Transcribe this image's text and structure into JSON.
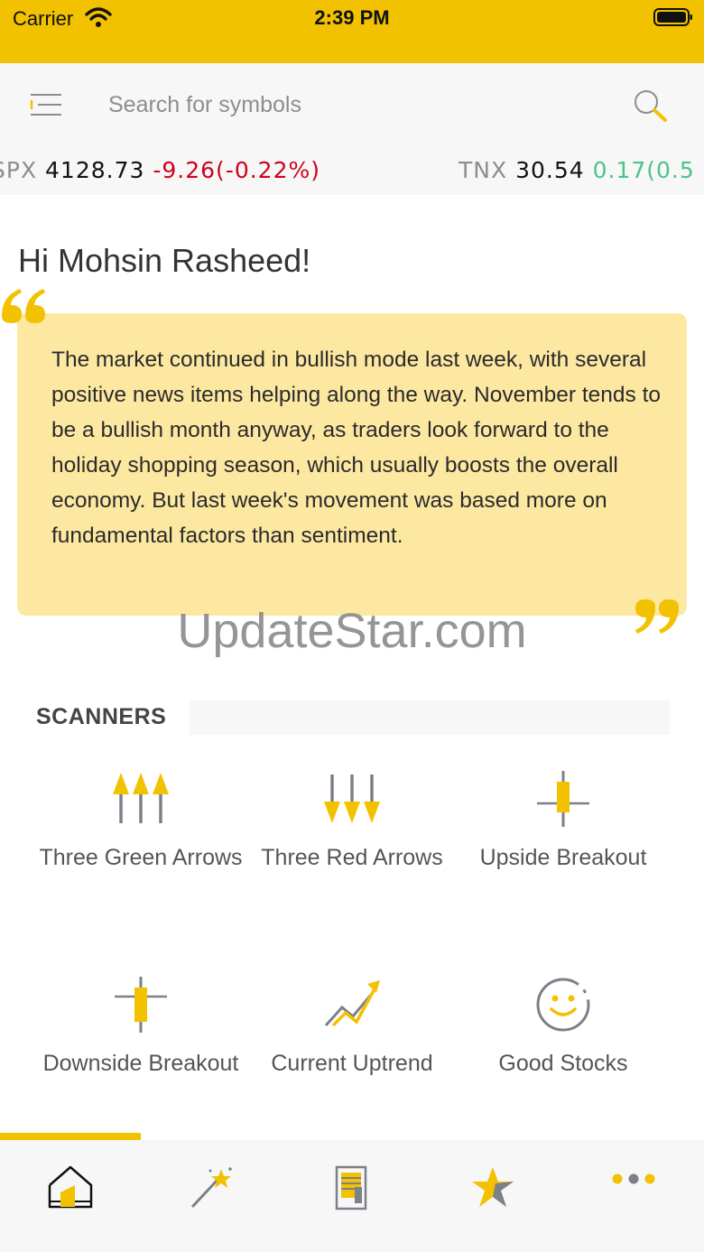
{
  "status_bar": {
    "carrier": "Carrier",
    "time": "2:39 PM"
  },
  "search": {
    "placeholder": "Search for symbols"
  },
  "ticker": [
    {
      "symbol": "SPX",
      "price": "4128.73",
      "change": "-9.26(-0.22%)",
      "direction": "down"
    },
    {
      "symbol": "TNX",
      "price": "30.54",
      "change": "0.17(0.5",
      "direction": "up"
    }
  ],
  "greeting": "Hi Mohsin Rasheed!",
  "quote": {
    "text": "The market continued in bullish mode last week, with several positive news items helping along the way. November tends to be a bullish month anyway, as traders look forward to the holiday shopping season, which usually boosts the overall economy. But last week's movement was based more on fundamental factors than sentiment."
  },
  "watermark": "UpdateStar.com",
  "scanners": {
    "title": "SCANNERS",
    "items": [
      {
        "label": "Three Green Arrows",
        "icon": "three-up-arrows-icon"
      },
      {
        "label": "Three Red Arrows",
        "icon": "three-down-arrows-icon"
      },
      {
        "label": "Upside Breakout",
        "icon": "upside-candle-icon"
      },
      {
        "label": "Downside Breakout",
        "icon": "downside-candle-icon"
      },
      {
        "label": "Current Uptrend",
        "icon": "uptrend-line-icon"
      },
      {
        "label": "Good Stocks",
        "icon": "smiley-icon"
      }
    ]
  },
  "tabs": [
    {
      "name": "home",
      "icon": "home-icon",
      "selected": true
    },
    {
      "name": "magic",
      "icon": "magic-wand-icon",
      "selected": false
    },
    {
      "name": "reports",
      "icon": "document-icon",
      "selected": false
    },
    {
      "name": "favorites",
      "icon": "star-icon",
      "selected": false
    },
    {
      "name": "more",
      "icon": "more-dots-icon",
      "selected": false
    }
  ],
  "colors": {
    "accent": "#f2c200",
    "quote_bg": "#fde8a2",
    "negative": "#d0021b",
    "positive": "#4cc38a",
    "icon_gray": "#7c8088"
  }
}
